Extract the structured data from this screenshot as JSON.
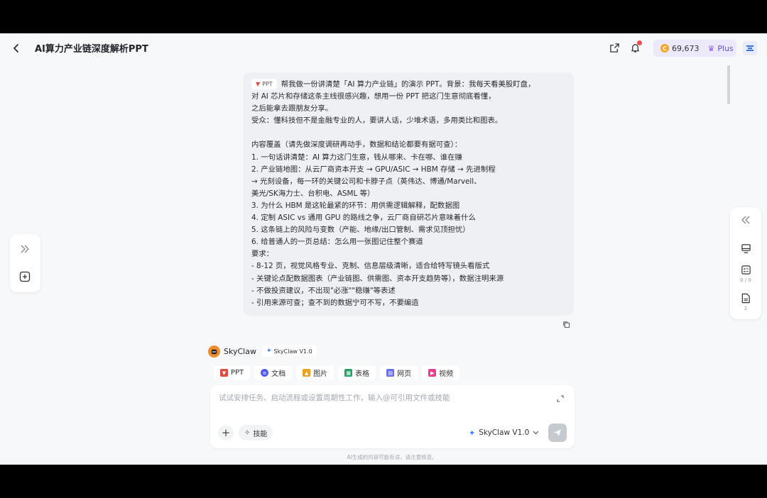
{
  "header": {
    "title": "AI算力产业链深度解析PPT",
    "credits": "69,673",
    "plan": "Plus"
  },
  "message": {
    "tag": "PPT",
    "lines": [
      "帮我做一份讲清楚「AI 算力产业链」的演示 PPT。背景：我每天看美股盯盘，",
      "对 AI 芯片和存储这条主线很感兴趣，想用一份 PPT 把这门生意彻底看懂，",
      "之后能拿去跟朋友分享。",
      "受众：懂科技但不是金融专业的人，要讲人话，少堆术语，多用类比和图表。",
      "",
      "内容覆盖（请先做深度调研再动手，数据和结论都要有据可查）：",
      "1. 一句话讲清楚：AI 算力这门生意，钱从哪来、卡在哪、谁在赚",
      "2. 产业链地图：从云厂商资本开支 → GPU/ASIC → HBM 存储 → 先进制程",
      "→ 光刻设备，每一环的关键公司和卡脖子点（英伟达、博通/Marvell、",
      "美光/SK海力士、台积电、ASML 等）",
      "3. 为什么 HBM 是这轮最紧的环节：用供需逻辑解释，配数据图",
      "4. 定制 ASIC vs 通用 GPU 的路线之争，云厂商自研芯片意味着什么",
      "5. 这条链上的风险与变数（产能、地缘/出口管制、需求见顶担忧）",
      "6. 给普通人的一页总结：怎么用一张图记住整个赛道",
      "要求：",
      "- 8-12 页，视觉风格专业、克制、信息层级清晰，适合给特写镜头看版式",
      "- 关键论点配数据图表（产业链图、供需图、资本开支趋势等），数据注明来源",
      "- 不做投资建议，不出现\"必涨\"\"稳赚\"等表述",
      "- 引用来源可查；查不到的数据宁可不写，不要编造"
    ]
  },
  "rightbar": {
    "todo_count": "0 / 0",
    "files_count": "2"
  },
  "agent": {
    "name": "SkyClaw",
    "version": "SkyClaw V1.0"
  },
  "chips": [
    {
      "label": "PPT",
      "color": "#e04a3a"
    },
    {
      "label": "文档",
      "color": "#4e5bf0"
    },
    {
      "label": "图片",
      "color": "#f0a020"
    },
    {
      "label": "表格",
      "color": "#21a366"
    },
    {
      "label": "网页",
      "color": "#6b6fe8"
    },
    {
      "label": "视频",
      "color": "#e83e8c"
    }
  ],
  "input": {
    "placeholder": "试试安排任务、启动流程或设置周期性工作，输入@可引用文件或技能",
    "skill_label": "技能",
    "model": "SkyClaw V1.0"
  },
  "footer": {
    "disclaimer": "AI生成的内容可能有误，请注意核查。"
  },
  "colors": {
    "accent": "#3a7bfd",
    "bubble": "#eef0f3",
    "background": "#f7f8fa"
  }
}
